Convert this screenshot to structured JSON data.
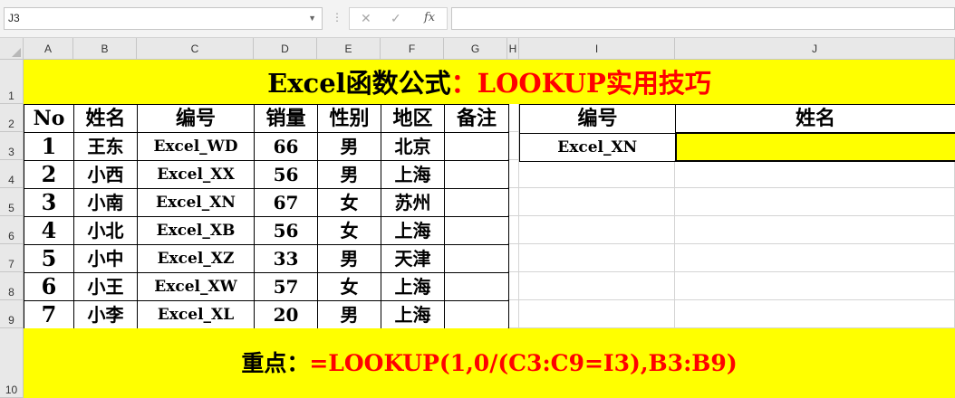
{
  "formula_bar": {
    "name_box": "J3",
    "cancel_icon": "✕",
    "enter_icon": "✓",
    "fx_label": "fx",
    "formula": ""
  },
  "columns": [
    "A",
    "B",
    "C",
    "D",
    "E",
    "F",
    "G",
    "H",
    "I",
    "J"
  ],
  "rows": [
    "1",
    "2",
    "3",
    "4",
    "5",
    "6",
    "7",
    "8",
    "9",
    "10"
  ],
  "title": {
    "part1": "Excel函数公式",
    "part2": "：LOOKUP实用技巧"
  },
  "table": {
    "headers": [
      "No",
      "姓名",
      "编号",
      "销量",
      "性别",
      "地区",
      "备注"
    ],
    "rows": [
      {
        "no": "1",
        "name": "王东",
        "code": "Excel_WD",
        "sales": "66",
        "gender": "男",
        "region": "北京",
        "note": ""
      },
      {
        "no": "2",
        "name": "小西",
        "code": "Excel_XX",
        "sales": "56",
        "gender": "男",
        "region": "上海",
        "note": ""
      },
      {
        "no": "3",
        "name": "小南",
        "code": "Excel_XN",
        "sales": "67",
        "gender": "女",
        "region": "苏州",
        "note": ""
      },
      {
        "no": "4",
        "name": "小北",
        "code": "Excel_XB",
        "sales": "56",
        "gender": "女",
        "region": "上海",
        "note": ""
      },
      {
        "no": "5",
        "name": "小中",
        "code": "Excel_XZ",
        "sales": "33",
        "gender": "男",
        "region": "天津",
        "note": ""
      },
      {
        "no": "6",
        "name": "小王",
        "code": "Excel_XW",
        "sales": "57",
        "gender": "女",
        "region": "上海",
        "note": ""
      },
      {
        "no": "7",
        "name": "小李",
        "code": "Excel_XL",
        "sales": "20",
        "gender": "男",
        "region": "上海",
        "note": ""
      }
    ]
  },
  "lookup": {
    "header_code": "编号",
    "header_name": "姓名",
    "code_value": "Excel_XN",
    "name_value": ""
  },
  "footer": {
    "label": "重点：",
    "formula": "=LOOKUP(1,0/(C3:C9=I3),B3:B9)"
  },
  "colors": {
    "highlight": "#ffff00",
    "title_red": "#ff0000"
  }
}
